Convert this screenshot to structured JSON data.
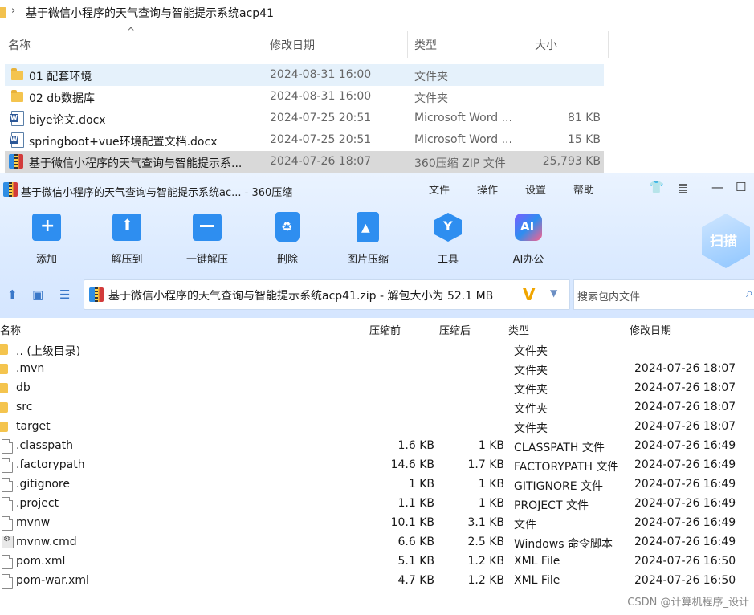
{
  "explorer": {
    "path": "基于微信小程序的天气查询与智能提示系统acp41",
    "columns": {
      "name": "名称",
      "date": "修改日期",
      "type": "类型",
      "size": "大小"
    },
    "rows": [
      {
        "name": "01 配套环境",
        "date": "2024-08-31 16:00",
        "type": "文件夹",
        "size": "",
        "icon": "folder-icon"
      },
      {
        "name": "02 db数据库",
        "date": "2024-08-31 16:00",
        "type": "文件夹",
        "size": "",
        "icon": "folder-icon"
      },
      {
        "name": "biye论文.docx",
        "date": "2024-07-25 20:51",
        "type": "Microsoft Word ...",
        "size": "81 KB",
        "icon": "word-doc-icon"
      },
      {
        "name": "springboot+vue环境配置文档.docx",
        "date": "2024-07-25 20:51",
        "type": "Microsoft Word ...",
        "size": "15 KB",
        "icon": "word-doc-icon"
      },
      {
        "name": "基于微信小程序的天气查询与智能提示系...",
        "date": "2024-07-26 18:07",
        "type": "360压缩 ZIP 文件",
        "size": "25,793 KB",
        "icon": "zip-archive-icon"
      }
    ]
  },
  "zipwin": {
    "title": "基于微信小程序的天气查询与智能提示系统ac... - 360压缩",
    "menu": [
      "文件",
      "操作",
      "设置",
      "帮助"
    ],
    "toolbar": [
      "添加",
      "解压到",
      "一键解压",
      "删除",
      "图片压缩",
      "工具",
      "AI办公"
    ],
    "scan_label": "扫描",
    "address": "基于微信小程序的天气查询与智能提示系统acp41.zip - 解包大小为 52.1 MB",
    "search_placeholder": "搜索包内文件",
    "columns": {
      "name": "名称",
      "packed": "压缩前",
      "compressed": "压缩后",
      "type": "类型",
      "date": "修改日期"
    },
    "files": [
      {
        "name": ".. (上级目录)",
        "packed": "",
        "compressed": "",
        "type": "文件夹",
        "date": "",
        "icon": "folder-icon"
      },
      {
        "name": ".mvn",
        "packed": "",
        "compressed": "",
        "type": "文件夹",
        "date": "2024-07-26 18:07",
        "icon": "folder-icon"
      },
      {
        "name": "db",
        "packed": "",
        "compressed": "",
        "type": "文件夹",
        "date": "2024-07-26 18:07",
        "icon": "folder-icon"
      },
      {
        "name": "src",
        "packed": "",
        "compressed": "",
        "type": "文件夹",
        "date": "2024-07-26 18:07",
        "icon": "folder-icon"
      },
      {
        "name": "target",
        "packed": "",
        "compressed": "",
        "type": "文件夹",
        "date": "2024-07-26 18:07",
        "icon": "folder-icon"
      },
      {
        "name": ".classpath",
        "packed": "1.6 KB",
        "compressed": "1 KB",
        "type": "CLASSPATH 文件",
        "date": "2024-07-26 16:49",
        "icon": "file-icon"
      },
      {
        "name": ".factorypath",
        "packed": "14.6 KB",
        "compressed": "1.7 KB",
        "type": "FACTORYPATH 文件",
        "date": "2024-07-26 16:49",
        "icon": "file-icon"
      },
      {
        "name": ".gitignore",
        "packed": "1 KB",
        "compressed": "1 KB",
        "type": "GITIGNORE 文件",
        "date": "2024-07-26 16:49",
        "icon": "file-icon"
      },
      {
        "name": ".project",
        "packed": "1.1 KB",
        "compressed": "1 KB",
        "type": "PROJECT 文件",
        "date": "2024-07-26 16:49",
        "icon": "file-icon"
      },
      {
        "name": "mvnw",
        "packed": "10.1 KB",
        "compressed": "3.1 KB",
        "type": "文件",
        "date": "2024-07-26 16:49",
        "icon": "file-icon"
      },
      {
        "name": "mvnw.cmd",
        "packed": "6.6 KB",
        "compressed": "2.5 KB",
        "type": "Windows 命令脚本",
        "date": "2024-07-26 16:49",
        "icon": "cmd-script-icon"
      },
      {
        "name": "pom.xml",
        "packed": "5.1 KB",
        "compressed": "1.2 KB",
        "type": "XML File",
        "date": "2024-07-26 16:50",
        "icon": "file-icon"
      },
      {
        "name": "pom-war.xml",
        "packed": "4.7 KB",
        "compressed": "1.2 KB",
        "type": "XML File",
        "date": "2024-07-26 16:50",
        "icon": "file-icon"
      }
    ]
  },
  "watermark": "CSDN @计算机程序_设计"
}
